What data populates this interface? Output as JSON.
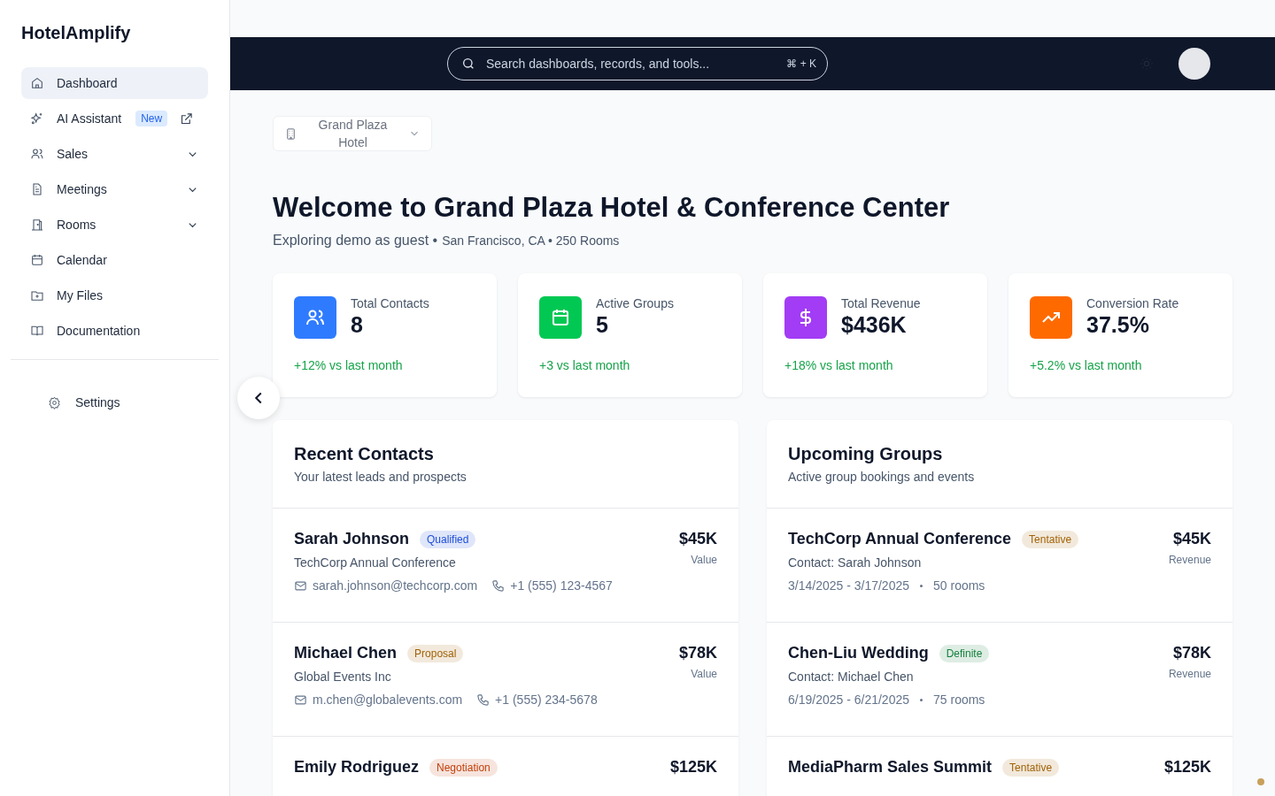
{
  "sidebar": {
    "logo": "HotelAmplify",
    "items": [
      {
        "label": "Dashboard",
        "selected": true
      },
      {
        "label": "AI Assistant",
        "selected": false,
        "badge": "New",
        "external": true
      },
      {
        "label": "Sales",
        "selected": false,
        "expanded": false
      },
      {
        "label": "Meetings",
        "selected": false,
        "expanded": false
      },
      {
        "label": "Rooms",
        "selected": false,
        "expanded": false
      },
      {
        "label": "Calendar",
        "selected": false
      },
      {
        "label": "My Files",
        "selected": false
      },
      {
        "label": "Documentation",
        "selected": false
      }
    ],
    "settings": "Settings"
  },
  "header": {
    "search": {
      "placeholder": "Search dashboards, records, and tools...",
      "shortcut": "⌘ + K"
    }
  },
  "hotel_selector": "Grand Plaza Hotel",
  "title": "Welcome to Grand Plaza Hotel & Conference Center",
  "subtitle": "Exploring demo as guest •",
  "location": "San Francisco, CA • 250 Rooms",
  "stats": [
    {
      "label": "Total Contacts",
      "value": "8",
      "change": "+12% vs last month",
      "color": "#2f7bff"
    },
    {
      "label": "Active Groups",
      "value": "5",
      "change": "+3 vs last month",
      "color": "#00c853"
    },
    {
      "label": "Total Revenue",
      "value": "$436K",
      "change": "+18% vs last month",
      "color": "#a23cf5"
    },
    {
      "label": "Conversion Rate",
      "value": "37.5%",
      "change": "+5.2% vs last month",
      "color": "#ff6a00"
    }
  ],
  "recent_contacts": {
    "title": "Recent Contacts",
    "subtitle": "Your latest leads and prospects",
    "rows": [
      {
        "name": "Sarah Johnson",
        "status": "Qualified",
        "color": "#1d4ed8",
        "company": "TechCorp Annual Conference",
        "email": "sarah.johnson@techcorp.com",
        "phone": "+1 (555) 123-4567",
        "value": "$45K",
        "value_label": "Value"
      },
      {
        "name": "Michael Chen",
        "status": "Proposal",
        "color": "#a16207",
        "company": "Global Events Inc",
        "email": "m.chen@globalevents.com",
        "phone": "+1 (555) 234-5678",
        "value": "$78K",
        "value_label": "Value"
      },
      {
        "name": "Emily Rodriguez",
        "status": "Negotiation",
        "color": "#c2410c",
        "value": "$125K"
      }
    ]
  },
  "upcoming_groups": {
    "title": "Upcoming Groups",
    "subtitle": "Active group bookings and events",
    "rows": [
      {
        "name": "TechCorp Annual Conference",
        "status": "Tentative",
        "color": "#a16207",
        "contact": "Contact: Sarah Johnson",
        "dates": "3/14/2025 - 3/17/2025",
        "rooms": "50 rooms",
        "value": "$45K",
        "value_label": "Revenue"
      },
      {
        "name": "Chen-Liu Wedding",
        "status": "Definite",
        "color": "#15803d",
        "contact": "Contact: Michael Chen",
        "dates": "6/19/2025 - 6/21/2025",
        "rooms": "75 rooms",
        "value": "$78K",
        "value_label": "Revenue"
      },
      {
        "name": "MediaPharm Sales Summit",
        "status": "Tentative",
        "color": "#a16207",
        "value": "$125K"
      }
    ]
  }
}
